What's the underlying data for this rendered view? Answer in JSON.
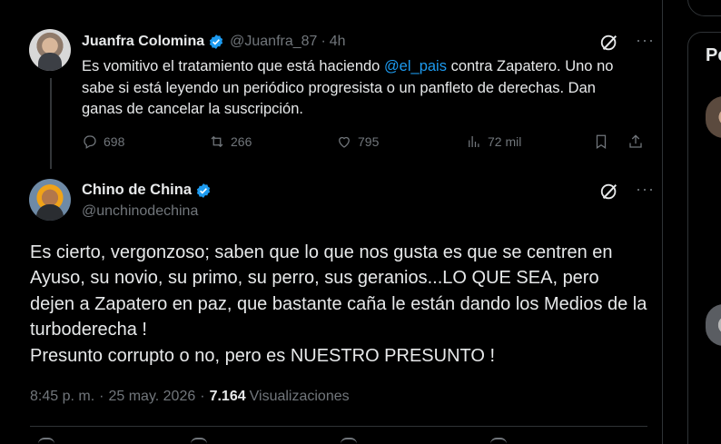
{
  "parent_tweet": {
    "author_name": "Juanfra Colomina",
    "handle": "@Juanfra_87",
    "separator": "·",
    "time": "4h",
    "text_before_mention": "Es vomitivo el tratamiento que está haciendo ",
    "mention": "@el_pais",
    "text_after_mention": " contra Zapatero. Uno no sabe si está leyendo un periódico progresista o un panfleto de derechas. Dan ganas de cancelar la suscripción.",
    "replies": "698",
    "reposts": "266",
    "likes": "795",
    "views": "72 mil"
  },
  "reply_tweet": {
    "author_name": "Chino de China",
    "handle": "@unchinodechina",
    "text_line1": "Es cierto, vergonzoso; saben que lo que nos gusta es que se centren en Ayuso, su novio, su primo, su perro, sus geranios...LO QUE SEA, pero dejen a Zapatero en paz, que bastante caña le están dando los Medios de la turboderecha !",
    "text_line2": "Presunto corrupto o no, pero es NUESTRO PRESUNTO !",
    "time": "8:45 p. m.",
    "meta_separator": "·",
    "date": "25 may. 2026",
    "views_count": "7.164",
    "views_label": "Visualizaciones"
  },
  "sidebar": {
    "panel_title_partial": "Pe"
  },
  "icons": {
    "verified": "verified-badge-icon",
    "grok": "grok-icon",
    "more": "more-icon",
    "reply": "reply-icon",
    "repost": "repost-icon",
    "like": "like-icon",
    "views": "views-icon",
    "bookmark": "bookmark-icon",
    "share": "share-icon"
  },
  "colors": {
    "background": "#000000",
    "text": "#e7e9ea",
    "muted": "#71767b",
    "accent": "#1d9bf0",
    "border": "#2f3336"
  }
}
